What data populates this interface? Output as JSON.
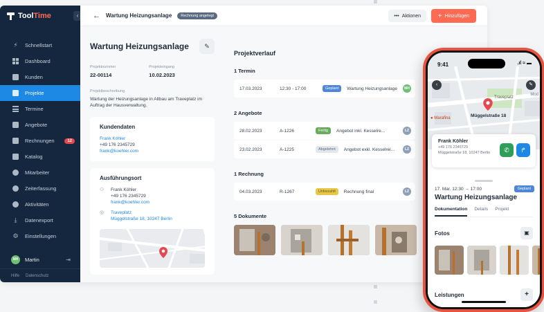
{
  "brand": {
    "name_prefix": "Tool",
    "name_suffix": "Time",
    "accent": "#ff6a52",
    "sidebar_bg": "#14273e",
    "primary": "#1e88e5"
  },
  "sidebar": {
    "items": [
      {
        "label": "Schnellstart",
        "icon": "bolt-icon"
      },
      {
        "label": "Dashboard",
        "icon": "dashboard-icon"
      },
      {
        "label": "Kunden",
        "icon": "contact-card-icon"
      },
      {
        "label": "Projekte",
        "icon": "folder-icon",
        "active": true
      },
      {
        "label": "Termine",
        "icon": "list-icon"
      },
      {
        "label": "Angebote",
        "icon": "document-icon"
      },
      {
        "label": "Rechnungen",
        "icon": "invoice-icon",
        "badge": "12"
      },
      {
        "label": "Katalog",
        "icon": "book-icon"
      },
      {
        "label": "Mitarbeiter",
        "icon": "users-icon"
      },
      {
        "label": "Zeiterfassung",
        "icon": "clock-icon"
      },
      {
        "label": "Aktivitäten",
        "icon": "activity-icon"
      },
      {
        "label": "Datenexport",
        "icon": "download-icon"
      },
      {
        "label": "Einstellungen",
        "icon": "gear-icon"
      }
    ],
    "user": {
      "initials": "MH",
      "name": "Martin"
    },
    "footer": {
      "help": "Hilfe",
      "privacy": "Datenschutz"
    }
  },
  "topbar": {
    "title": "Wartung Heizungsanlage",
    "status": "Rechnung angelegt",
    "actions_label": "Aktionen",
    "add_label": "Hinzufügen"
  },
  "project": {
    "title": "Wartung Heizungsanlage",
    "number_label": "Projektnummer",
    "number": "22-00114",
    "received_label": "Projekteingang",
    "received": "10.02.2023",
    "description_label": "Projektbeschreibung",
    "description": "Wartung der Heizungsanlage in Altbau am Traveplatz im Auftrag der Hausverwaltung.",
    "customer": {
      "title": "Kundendaten",
      "name": "Frank Köhler",
      "phone": "+49 176 2345729",
      "email": "frank@koehler.com"
    },
    "site": {
      "title": "Ausführungsort",
      "name": "Frank Köhler",
      "phone": "+49 176 2345729",
      "email": "frank@koehler.com",
      "place": "Traveplatz",
      "address": "Müggelstraße 18, 10247 Berlin"
    }
  },
  "history": {
    "title": "Projektverlauf",
    "termin_h": "1 Termin",
    "termine": [
      {
        "date": "17.03.2023",
        "time": "12:30 - 17:00",
        "status": "Geplant",
        "text": "Wartung Heizungsanlage",
        "initials": "MH"
      }
    ],
    "angebote_h": "2 Angebote",
    "angebote": [
      {
        "date": "28.02.2023",
        "num": "A-1226",
        "status": "Fertig",
        "text": "Angebot inkl. Kesselre...",
        "initials": "LZ"
      },
      {
        "date": "23.02.2023",
        "num": "A-1225",
        "status": "Abgelehnt",
        "text": "Angebot exkl. Kesselrei...",
        "initials": "LZ"
      }
    ],
    "rechnung_h": "1 Rechnung",
    "rechnungen": [
      {
        "date": "04.03.2023",
        "num": "R-1267",
        "status": "Unbezahlt",
        "text": "Rechnung final",
        "initials": "LZ"
      }
    ],
    "dokumente_h": "5 Dokumente"
  },
  "phone": {
    "time": "9:41",
    "map_place": "Traveplatz",
    "map_street": "Müggelstraße 18",
    "map_poi": "Marafina",
    "map_edge": "Mod",
    "contact": {
      "name": "Frank Köhler",
      "phone": "+49 176 2345729",
      "address": "Müggelstraße 18, 10247 Berlin"
    },
    "appointment": {
      "date": "17. Mar. 12:30 → 17:00",
      "status": "Geplant",
      "title": "Wartung Heizungsanlage"
    },
    "tabs": [
      "Dokumentation",
      "Details",
      "Projekt"
    ],
    "fotos_h": "Fotos",
    "leistungen_h": "Leistungen"
  }
}
